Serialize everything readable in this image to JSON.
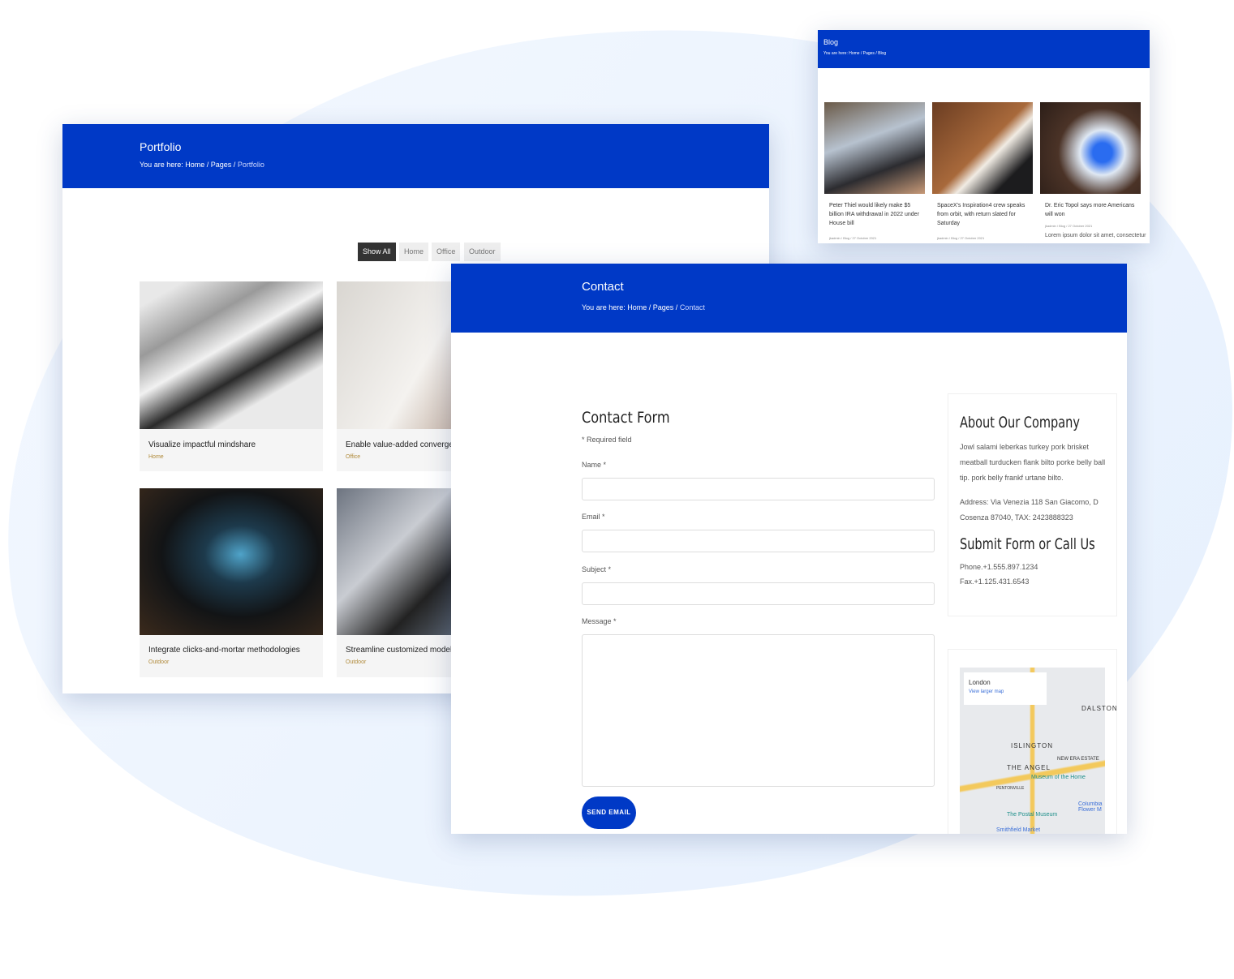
{
  "blog": {
    "title": "Blog",
    "crumb": {
      "prefix": "You are here:",
      "home": "Home",
      "pages": "Pages",
      "current": "Blog"
    },
    "posts": [
      {
        "title": "Peter Thiel would likely make $5 billion IRA withdrawal in 2022 under House bill",
        "meta": "jkadmin  /  Blog  /  27 October 2021"
      },
      {
        "title": "SpaceX's Inspiration4 crew speaks from orbit, with return slated for Saturday",
        "meta": "jkadmin  /  Blog  /  27 October 2021"
      },
      {
        "title": "Dr. Eric Topol says more Americans will won",
        "meta": "jkadmin  /  Blog  /  27 October 2021",
        "excerpt": "Lorem ipsum dolor sit amet, consectetur"
      }
    ]
  },
  "portfolio": {
    "title": "Portfolio",
    "crumb": {
      "prefix": "You are here:",
      "home": "Home",
      "pages": "Pages",
      "current": "Portfolio"
    },
    "filters": [
      "Show All",
      "Home",
      "Office",
      "Outdoor"
    ],
    "items": [
      {
        "title": "Visualize impactful mindshare",
        "category": "Home"
      },
      {
        "title": "Enable value-added convergence",
        "category": "Office"
      },
      {
        "title": "Integrate clicks-and-mortar methodologies",
        "category": "Outdoor"
      },
      {
        "title": "Streamline customized models",
        "category": "Outdoor"
      }
    ]
  },
  "contact": {
    "title": "Contact",
    "crumb": {
      "prefix": "You are here:",
      "home": "Home",
      "pages": "Pages",
      "current": "Contact"
    },
    "form": {
      "heading": "Contact Form",
      "required_note": "* Required field",
      "name_label": "Name *",
      "email_label": "Email *",
      "subject_label": "Subject *",
      "message_label": "Message *",
      "send_label": "SEND EMAIL"
    },
    "about": {
      "heading": "About Our Company",
      "text": "Jowl salami leberkas turkey pork brisket meatball turducken flank bilto porke belly ball tip. pork belly frankf urtane bilto.",
      "address": "Address: Via Venezia 118 San Giacomo, D Cosenza 87040, TAX: 2423888323",
      "call_heading": "Submit Form or Call Us",
      "phone": "Phone.+1.555.897.1234",
      "fax": "Fax.+1.125.431.6543"
    },
    "map": {
      "place": "London",
      "link": "View larger map",
      "labels": [
        "ISLINGTON",
        "THE ANGEL",
        "DALSTON",
        "NEW ERA ESTATE",
        "Museum of the Home",
        "The Postal Museum",
        "Smithfield Market",
        "PENTONVILLE",
        "Columbia Flower M"
      ]
    }
  },
  "colors": {
    "brand": "#0039c6",
    "active_filter": "#333333"
  }
}
